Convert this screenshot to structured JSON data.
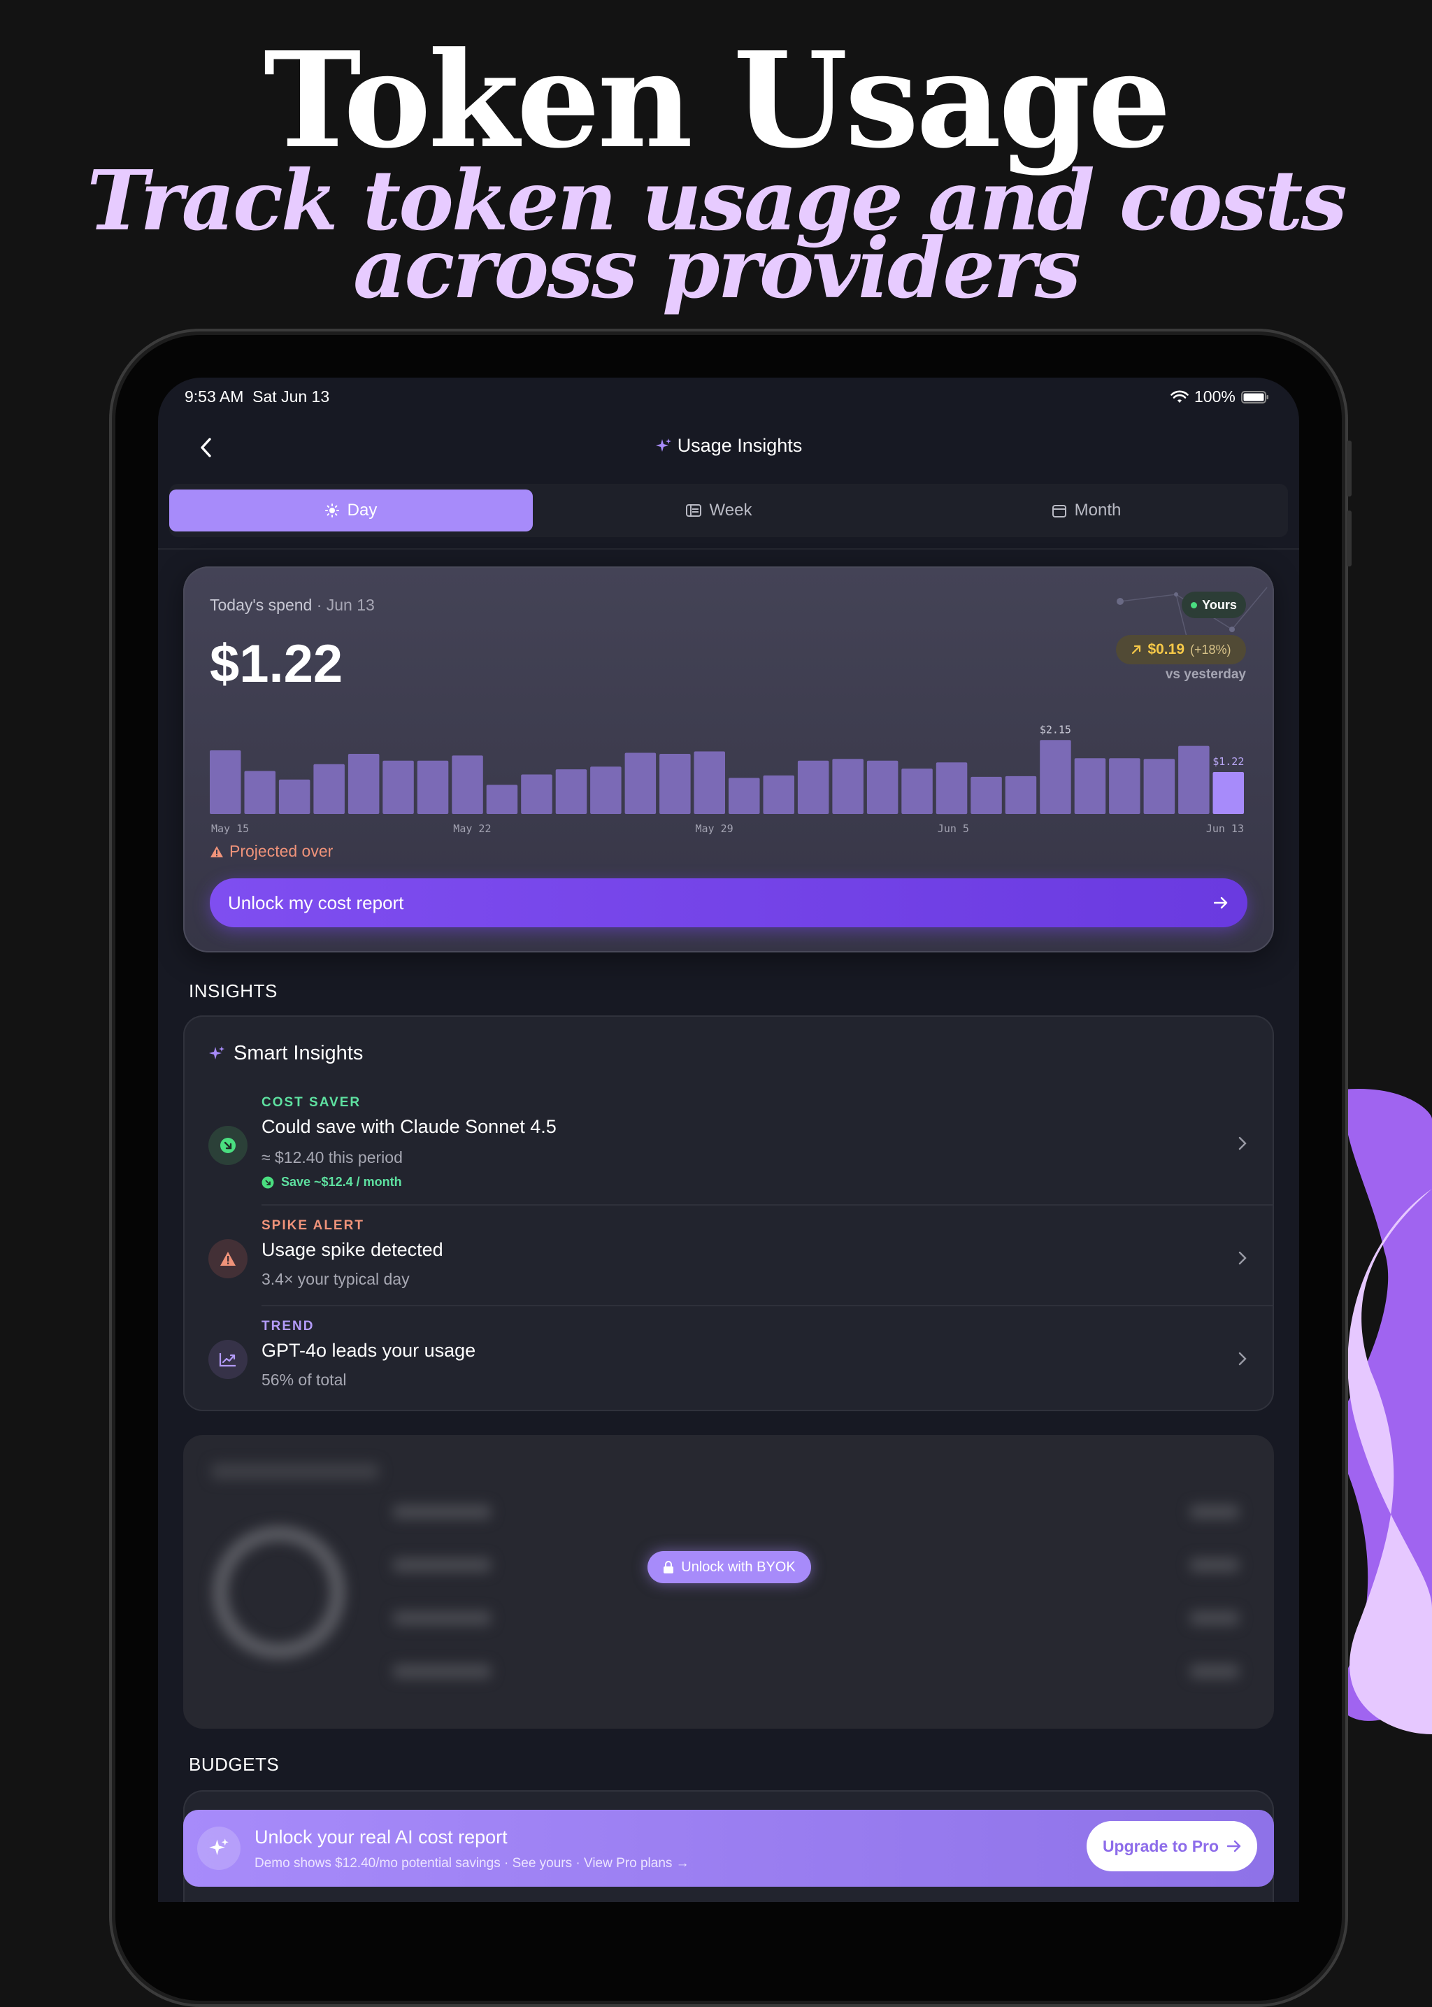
{
  "hero": {
    "title": "Token Usage",
    "subtitle_line1": "Track token usage and costs",
    "subtitle_line2": "across providers"
  },
  "status_bar": {
    "time": "9:53 AM",
    "date": "Sat Jun 13",
    "battery": "100%"
  },
  "nav": {
    "title": "Usage Insights"
  },
  "tabs": [
    {
      "label": "Day",
      "active": true
    },
    {
      "label": "Week",
      "active": false
    },
    {
      "label": "Month",
      "active": false
    }
  ],
  "spend_card": {
    "label": "Today's spend",
    "date": "· Jun 13",
    "amount": "$1.22",
    "badge": "Yours",
    "delta": "$0.19",
    "delta_pct": "(+18%)",
    "delta_caption": "vs yesterday",
    "warning": "Projected over",
    "cta_label": "Unlock my cost report"
  },
  "chart_data": {
    "type": "bar",
    "values": [
      1.85,
      1.25,
      1.0,
      1.45,
      1.75,
      1.55,
      1.55,
      1.7,
      0.85,
      1.15,
      1.3,
      1.38,
      1.78,
      1.75,
      1.82,
      1.05,
      1.12,
      1.55,
      1.6,
      1.55,
      1.32,
      1.5,
      1.08,
      1.1,
      2.15,
      1.62,
      1.62,
      1.6,
      1.98,
      1.22
    ],
    "highlight_index": 29,
    "x_tick_labels": [
      {
        "index": 0,
        "label": "May 15"
      },
      {
        "index": 7,
        "label": "May 22"
      },
      {
        "index": 14,
        "label": "May 29"
      },
      {
        "index": 21,
        "label": "Jun 5"
      },
      {
        "index": 29,
        "label": "Jun 13"
      }
    ],
    "data_labels": [
      {
        "index": 24,
        "label": "$2.15"
      },
      {
        "index": 29,
        "label": "$1.22"
      }
    ],
    "ylim": [
      0,
      2.4
    ],
    "grid": false,
    "colors": {
      "bar": "#7b6ab6",
      "highlight": "#a78bfa"
    }
  },
  "insights": {
    "section_label": "INSIGHTS",
    "card_title": "Smart Insights",
    "items": [
      {
        "tag": "COST SAVER",
        "tag_color": "#5ee0a0",
        "title": "Could save with Claude Sonnet 4.5",
        "subtitle": "≈ $12.40 this period",
        "extra": "Save ~$12.4 / month",
        "icon": "arrow-down-right-icon"
      },
      {
        "tag": "SPIKE ALERT",
        "tag_color": "#f0937a",
        "title": "Usage spike detected",
        "subtitle": "3.4× your typical day",
        "icon": "warning-icon"
      },
      {
        "tag": "TREND",
        "tag_color": "#b39bf8",
        "title": "GPT-4o leads your usage",
        "subtitle": "56% of total",
        "icon": "trend-chart-icon"
      }
    ]
  },
  "locked": {
    "unlock_label": "Unlock with BYOK"
  },
  "budgets": {
    "section_label": "BUDGETS"
  },
  "promo": {
    "title": "Unlock your real AI cost report",
    "subtitle": "Demo shows $12.40/mo potential savings · See yours · View Pro plans →",
    "button_label": "Upgrade to Pro"
  }
}
